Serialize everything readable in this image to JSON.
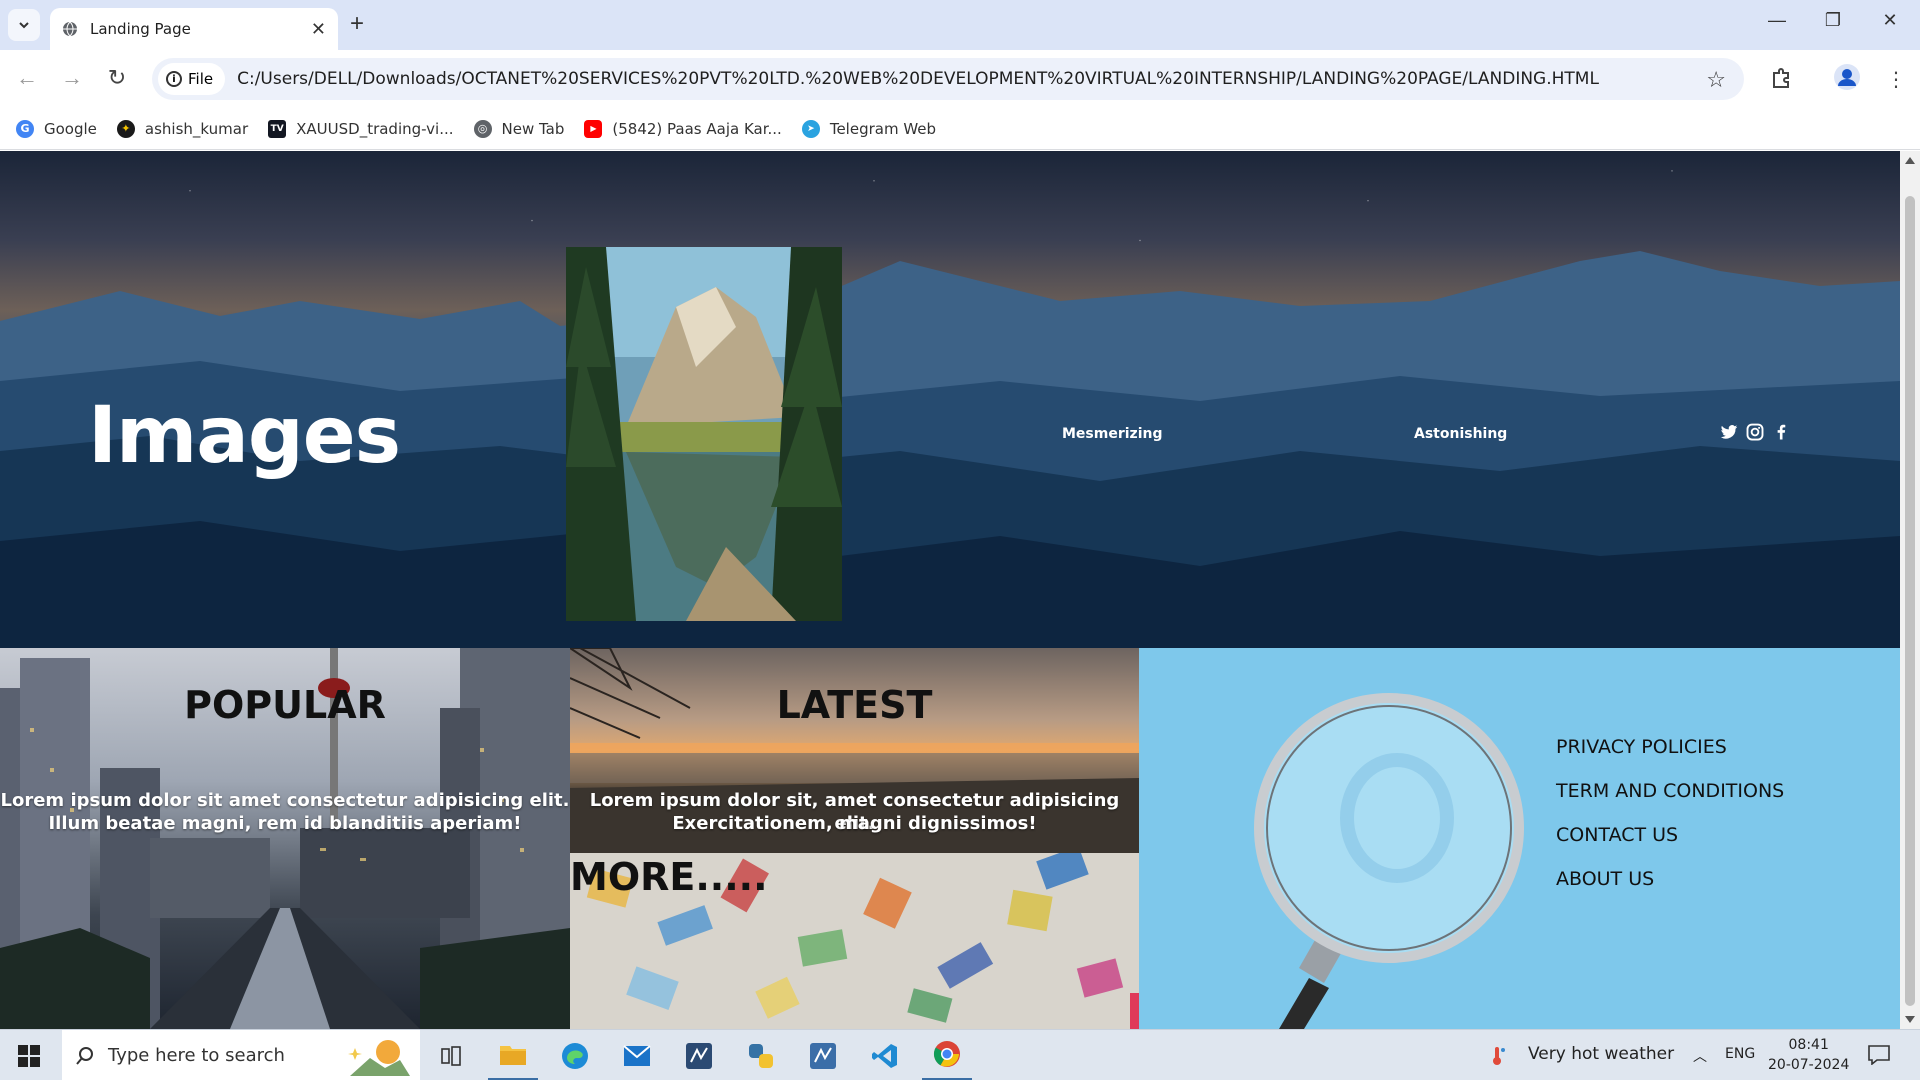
{
  "browser": {
    "tab_title": "Landing Page",
    "site_chip": "File",
    "url": "C:/Users/DELL/Downloads/OCTANET%20SERVICES%20PVT%20LTD.%20WEB%20DEVELOPMENT%20VIRTUAL%20INTERNSHIP/LANDING%20PAGE/LANDING.HTML",
    "bookmarks": [
      {
        "label": "Google",
        "icon": "google-icon",
        "color": "#4285f4"
      },
      {
        "label": "ashish_kumar",
        "icon": "profile-icon",
        "color": "#1a1a1a"
      },
      {
        "label": "XAUUSD_trading-vi...",
        "icon": "tradingview-icon",
        "color": "#131722"
      },
      {
        "label": "New Tab",
        "icon": "globe-icon",
        "color": "#5f6368"
      },
      {
        "label": "(5842) Paas Aaja Kar...",
        "icon": "youtube-icon",
        "color": "#ff0000"
      },
      {
        "label": "Telegram Web",
        "icon": "telegram-icon",
        "color": "#2aa3e0"
      }
    ]
  },
  "hero": {
    "title": "Images",
    "links": [
      "Mesmerizing",
      "Astonishing"
    ],
    "social": [
      "twitter-icon",
      "instagram-icon",
      "facebook-icon"
    ]
  },
  "cards": {
    "popular": {
      "title": "POPULAR",
      "text_line1": "Lorem ipsum dolor sit amet consectetur adipisicing elit.",
      "text_line2": "Illum beatae magni, rem id blanditiis aperiam!"
    },
    "latest": {
      "title": "LATEST",
      "text_line1": "Lorem ipsum dolor sit, amet consectetur adipisicing elit.",
      "text_line2": "Exercitationem, magni dignissimos!"
    },
    "more": {
      "title": "MORE....."
    }
  },
  "footer_links": [
    "PRIVACY POLICIES",
    "TERM AND CONDITIONS",
    "CONTACT US",
    "ABOUT US"
  ],
  "taskbar": {
    "search_placeholder": "Type here to search",
    "weather": "Very hot weather",
    "language": "ENG",
    "time": "08:41",
    "date": "20-07-2024"
  },
  "colors": {
    "tab_strip": "#dbe4f7",
    "links_panel": "#7ec8eb",
    "taskbar": "#dfe6ef"
  }
}
